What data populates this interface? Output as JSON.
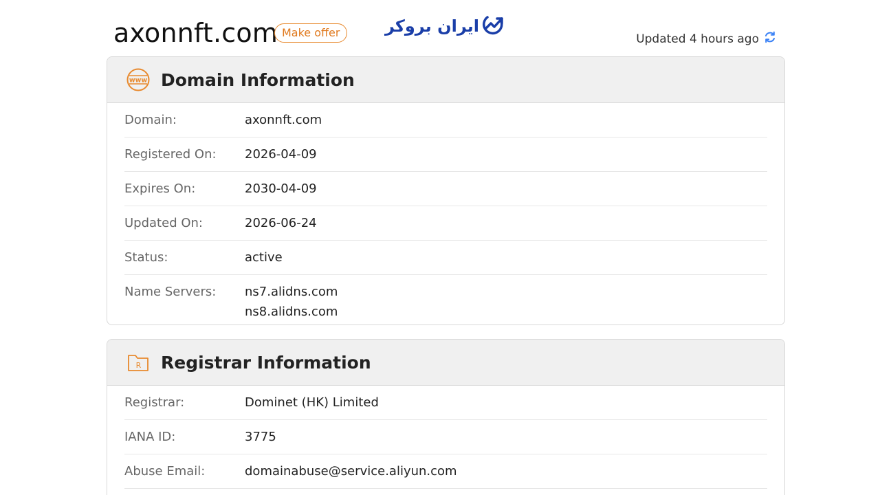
{
  "header": {
    "domain": "axonnft.com",
    "offer_label": "Make offer",
    "brand_text": "ایران بروکر",
    "updated_text": "Updated 4 hours ago"
  },
  "domain_info": {
    "title": "Domain Information",
    "rows": [
      {
        "label": "Domain:",
        "value": "axonnft.com"
      },
      {
        "label": "Registered On:",
        "value": "2026-04-09"
      },
      {
        "label": "Expires On:",
        "value": "2030-04-09"
      },
      {
        "label": "Updated On:",
        "value": "2026-06-24"
      },
      {
        "label": "Status:",
        "value": "active"
      },
      {
        "label": "Name Servers:",
        "values": [
          "ns7.alidns.com",
          "ns8.alidns.com"
        ]
      }
    ]
  },
  "registrar_info": {
    "title": "Registrar Information",
    "rows": [
      {
        "label": "Registrar:",
        "value": "Dominet (HK) Limited"
      },
      {
        "label": "IANA ID:",
        "value": "3775"
      },
      {
        "label": "Abuse Email:",
        "value": "domainabuse@service.aliyun.com"
      }
    ]
  },
  "colors": {
    "accent": "#e8892d",
    "brand": "#1a3ea8",
    "refresh": "#3b82f6"
  }
}
